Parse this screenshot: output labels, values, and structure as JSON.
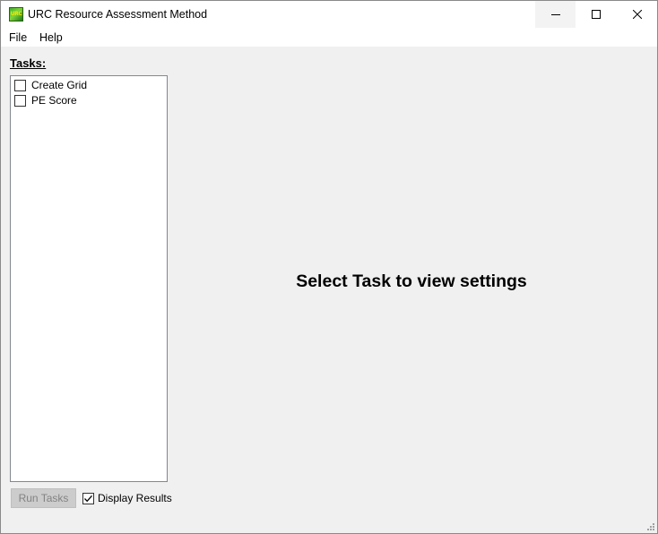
{
  "window": {
    "title": "URC Resource Assessment Method",
    "icon_text": "URC",
    "icon": "app-logo-icon"
  },
  "controls": {
    "minimize_icon": "minimize-icon",
    "maximize_icon": "maximize-icon",
    "close_icon": "close-icon"
  },
  "menu": {
    "items": [
      {
        "label": "File"
      },
      {
        "label": "Help"
      }
    ]
  },
  "tasks": {
    "heading": "Tasks:",
    "items": [
      {
        "label": "Create Grid",
        "checked": false
      },
      {
        "label": "PE Score",
        "checked": false
      }
    ]
  },
  "actions": {
    "run_label": "Run Tasks",
    "run_enabled": false,
    "display_results_label": "Display Results",
    "display_results_checked": true
  },
  "main": {
    "message": "Select Task to view settings"
  },
  "colors": {
    "window_bg": "#f0f0f0",
    "titlebar_bg": "#ffffff",
    "list_border": "#828790",
    "disabled_button_bg": "#cccccc",
    "disabled_text": "#838383"
  }
}
